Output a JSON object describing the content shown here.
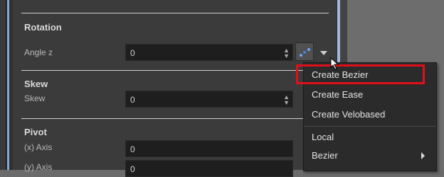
{
  "rotation": {
    "title": "Rotation",
    "angle_label": "Angle z",
    "angle_value": "0",
    "function_button_icon": "bezier-curve-icon"
  },
  "skew": {
    "title": "Skew",
    "skew_label": "Skew",
    "skew_value": "0"
  },
  "pivot": {
    "title": "Pivot",
    "x_label": "(x) Axis",
    "x_value": "0",
    "y_label": "(y) Axis",
    "y_value": "0"
  },
  "context_menu": {
    "items": [
      {
        "label": "Create Bezier"
      },
      {
        "label": "Create Ease"
      },
      {
        "label": "Create Velobased"
      },
      {
        "label": "Local"
      },
      {
        "label": "Bezier"
      }
    ]
  },
  "colors": {
    "highlight_box": "#e10f1a",
    "accent_blue": "#6aa8ff"
  }
}
